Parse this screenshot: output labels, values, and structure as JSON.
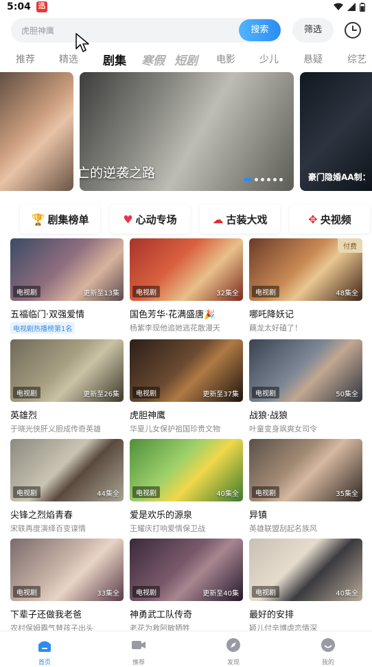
{
  "status": {
    "time": "5:04",
    "app_badge": "迅"
  },
  "search": {
    "placeholder": "虎胆神鹰",
    "button": "搜索",
    "filter": "筛选"
  },
  "tabs": [
    "推荐",
    "精选",
    "剧集",
    "寒假",
    "短剧",
    "电影",
    "少儿",
    "悬疑",
    "综艺"
  ],
  "banners": [
    {
      "caption": ""
    },
    {
      "caption": "亡的逆袭之路"
    },
    {
      "caption": "豪门隐婚AA制："
    }
  ],
  "channels": [
    "剧集榜单",
    "心动专场",
    "古装大戏",
    "央视频"
  ],
  "cards": [
    {
      "title": "五福临门·双强爱情",
      "sub": "",
      "rank": "电视剧热播榜第1名",
      "tag": "电视剧",
      "ep": "更新至13集",
      "pay": ""
    },
    {
      "title": "国色芳华·花满盛唐🎉",
      "sub": "杨紫李现他追她逃花散漫天",
      "rank": "",
      "tag": "电视剧",
      "ep": "32集全",
      "pay": ""
    },
    {
      "title": "哪吒降妖记",
      "sub": "藕龙太好磕了！",
      "rank": "",
      "tag": "电视剧",
      "ep": "48集全",
      "pay": "付费"
    },
    {
      "title": "英雄烈",
      "sub": "于晓光侠肝义胆成传奇英雄",
      "rank": "",
      "tag": "电视剧",
      "ep": "更新至26集",
      "pay": ""
    },
    {
      "title": "虎胆神鹰",
      "sub": "华夏儿女保护祖国珍贵文物",
      "rank": "",
      "tag": "电视剧",
      "ep": "更新至37集",
      "pay": ""
    },
    {
      "title": "战狼·战狼",
      "sub": "叶童变身飒爽女司令",
      "rank": "",
      "tag": "电视剧",
      "ep": "50集全",
      "pay": ""
    },
    {
      "title": "尖锋之烈焰青春",
      "sub": "宋轶再度演绎百变谍情",
      "rank": "",
      "tag": "电视剧",
      "ep": "44集全",
      "pay": ""
    },
    {
      "title": "爱是欢乐的源泉",
      "sub": "王耀庆打响爱情保卫战",
      "rank": "",
      "tag": "电视剧",
      "ep": "40集全",
      "pay": ""
    },
    {
      "title": "异镇",
      "sub": "英雄联盟刮起名族风",
      "rank": "",
      "tag": "电视剧",
      "ep": "35集全",
      "pay": ""
    },
    {
      "title": "下辈子还做我老爸",
      "sub": "农村保姆霸气替孩子出头",
      "rank": "",
      "tag": "电视剧",
      "ep": "33集全",
      "pay": ""
    },
    {
      "title": "神勇武工队传奇",
      "sub": "老花为救阿敏牺牲",
      "rank": "",
      "tag": "电视剧",
      "ep": "更新至40集",
      "pay": ""
    },
    {
      "title": "最好的安排",
      "sub": "颖儿付辛博虐恋情深",
      "rank": "",
      "tag": "电视剧",
      "ep": "40集全",
      "pay": ""
    }
  ],
  "bottom_nav": [
    "首页",
    "推荐",
    "发现",
    "我的"
  ],
  "colors": {
    "accent": "#2a8df2",
    "text": "#111111",
    "muted": "#8a8a8a"
  }
}
